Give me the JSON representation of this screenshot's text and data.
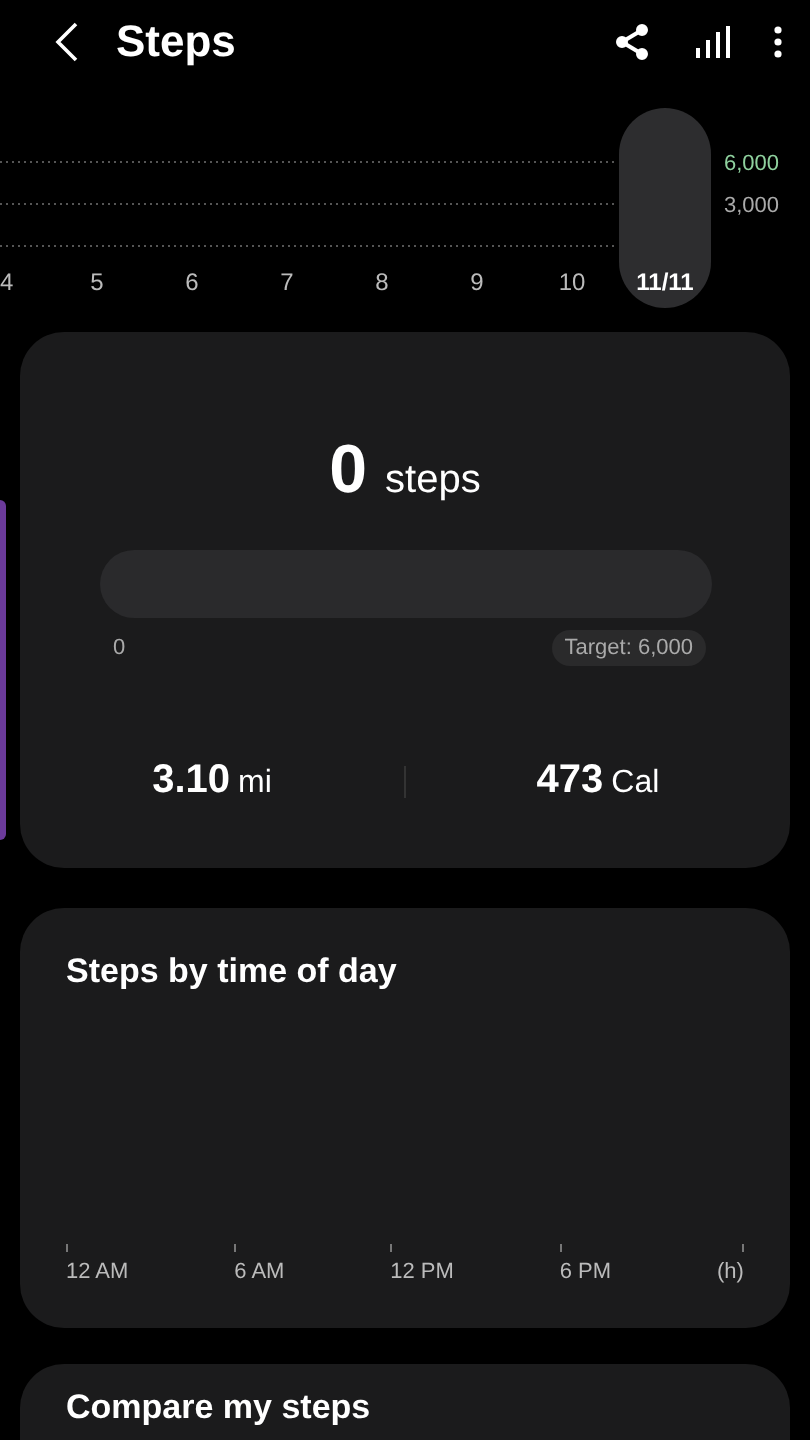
{
  "header": {
    "title": "Steps"
  },
  "weekly_chart": {
    "days": [
      {
        "label": "4",
        "selected": false
      },
      {
        "label": "5",
        "selected": false
      },
      {
        "label": "6",
        "selected": false
      },
      {
        "label": "7",
        "selected": false
      },
      {
        "label": "8",
        "selected": false
      },
      {
        "label": "9",
        "selected": false
      },
      {
        "label": "10",
        "selected": false
      },
      {
        "label": "11/11",
        "selected": true
      }
    ],
    "gridlines": [
      {
        "label": "6,000",
        "kind": "target"
      },
      {
        "label": "3,000",
        "kind": "plain"
      }
    ]
  },
  "summary": {
    "count": "0",
    "unit": "steps",
    "progress": {
      "level": 0,
      "start": "0",
      "target": "Target: 6,000"
    },
    "stats": [
      {
        "value": "3.10",
        "unit": "mi"
      },
      {
        "value": "473",
        "unit": "Cal"
      }
    ]
  },
  "time_of_day": {
    "title": "Steps by time of day",
    "axis_labels": [
      "12 AM",
      "6 AM",
      "12 PM",
      "6 PM",
      "(h)"
    ]
  },
  "compare": {
    "title": "Compare my steps"
  }
}
